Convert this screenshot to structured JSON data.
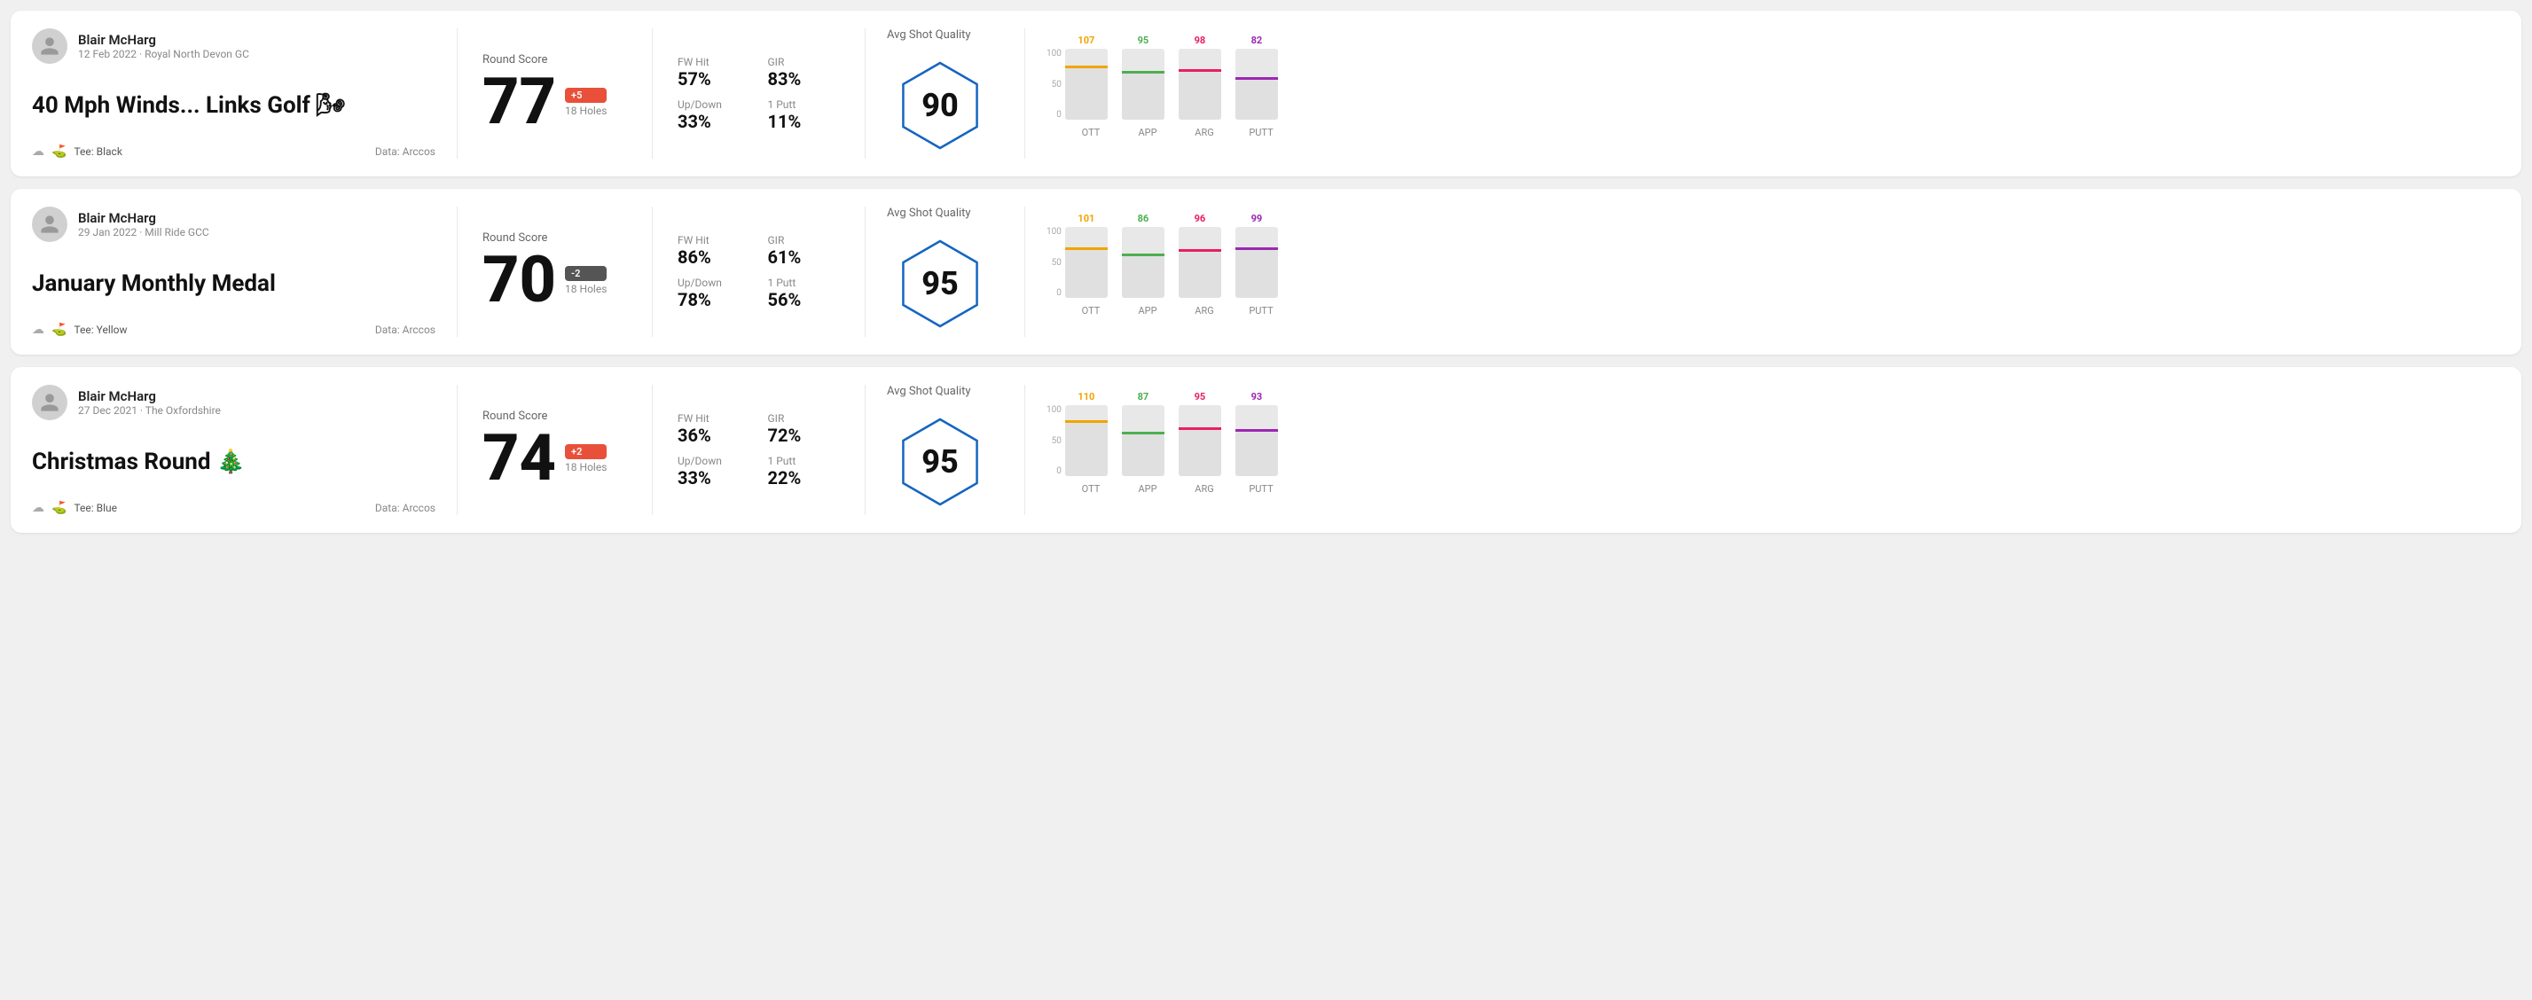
{
  "rounds": [
    {
      "id": "round1",
      "user": {
        "name": "Blair McHarg",
        "date": "12 Feb 2022",
        "course": "Royal North Devon GC"
      },
      "title": "40 Mph Winds... Links Golf 🌬",
      "tee": "Black",
      "data_source": "Data: Arccos",
      "round_score_label": "Round Score",
      "score": "77",
      "score_diff": "+5",
      "score_diff_sign": "positive",
      "holes": "18 Holes",
      "stats": {
        "fw_hit_label": "FW Hit",
        "fw_hit_value": "57%",
        "gir_label": "GIR",
        "gir_value": "83%",
        "updown_label": "Up/Down",
        "updown_value": "33%",
        "one_putt_label": "1 Putt",
        "one_putt_value": "11%"
      },
      "avg_shot_quality_label": "Avg Shot Quality",
      "shot_quality_score": "90",
      "chart": {
        "ott": {
          "value": 107,
          "color": "#f0a500",
          "pct": 72
        },
        "app": {
          "value": 95,
          "color": "#4caf50",
          "pct": 65
        },
        "arg": {
          "value": 98,
          "color": "#e91e63",
          "pct": 67
        },
        "putt": {
          "value": 82,
          "color": "#9c27b0",
          "pct": 56
        }
      }
    },
    {
      "id": "round2",
      "user": {
        "name": "Blair McHarg",
        "date": "29 Jan 2022",
        "course": "Mill Ride GCC"
      },
      "title": "January Monthly Medal",
      "tee": "Yellow",
      "data_source": "Data: Arccos",
      "round_score_label": "Round Score",
      "score": "70",
      "score_diff": "-2",
      "score_diff_sign": "negative",
      "holes": "18 Holes",
      "stats": {
        "fw_hit_label": "FW Hit",
        "fw_hit_value": "86%",
        "gir_label": "GIR",
        "gir_value": "61%",
        "updown_label": "Up/Down",
        "updown_value": "78%",
        "one_putt_label": "1 Putt",
        "one_putt_value": "56%"
      },
      "avg_shot_quality_label": "Avg Shot Quality",
      "shot_quality_score": "95",
      "chart": {
        "ott": {
          "value": 101,
          "color": "#f0a500",
          "pct": 68
        },
        "app": {
          "value": 86,
          "color": "#4caf50",
          "pct": 59
        },
        "arg": {
          "value": 96,
          "color": "#e91e63",
          "pct": 65
        },
        "putt": {
          "value": 99,
          "color": "#9c27b0",
          "pct": 67
        }
      }
    },
    {
      "id": "round3",
      "user": {
        "name": "Blair McHarg",
        "date": "27 Dec 2021",
        "course": "The Oxfordshire"
      },
      "title": "Christmas Round 🎄",
      "tee": "Blue",
      "data_source": "Data: Arccos",
      "round_score_label": "Round Score",
      "score": "74",
      "score_diff": "+2",
      "score_diff_sign": "positive",
      "holes": "18 Holes",
      "stats": {
        "fw_hit_label": "FW Hit",
        "fw_hit_value": "36%",
        "gir_label": "GIR",
        "gir_value": "72%",
        "updown_label": "Up/Down",
        "updown_value": "33%",
        "one_putt_label": "1 Putt",
        "one_putt_value": "22%"
      },
      "avg_shot_quality_label": "Avg Shot Quality",
      "shot_quality_score": "95",
      "chart": {
        "ott": {
          "value": 110,
          "color": "#f0a500",
          "pct": 75
        },
        "app": {
          "value": 87,
          "color": "#4caf50",
          "pct": 59
        },
        "arg": {
          "value": 95,
          "color": "#e91e63",
          "pct": 65
        },
        "putt": {
          "value": 93,
          "color": "#9c27b0",
          "pct": 63
        }
      }
    }
  ],
  "chart_labels": {
    "ott": "OTT",
    "app": "APP",
    "arg": "ARG",
    "putt": "PUTT"
  },
  "chart_y_labels": [
    "100",
    "50",
    "0"
  ]
}
